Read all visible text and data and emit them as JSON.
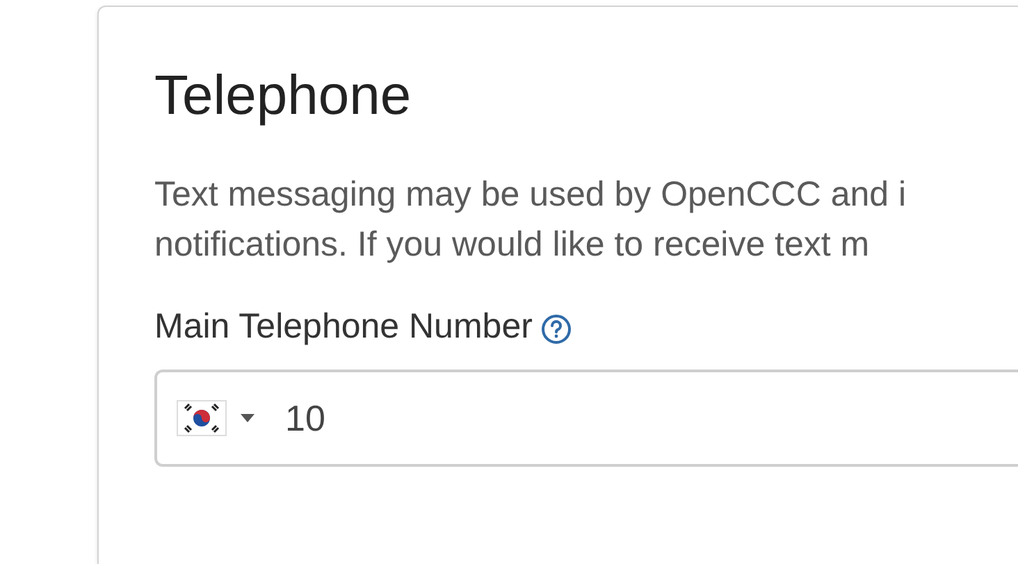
{
  "card": {
    "title": "Telephone",
    "description_lines": [
      "Text messaging may be used by OpenCCC and i",
      "notifications. If you would like to receive text m"
    ],
    "field": {
      "label": "Main Telephone Number",
      "country_selector": {
        "kind": "korea"
      },
      "value": "10"
    }
  }
}
